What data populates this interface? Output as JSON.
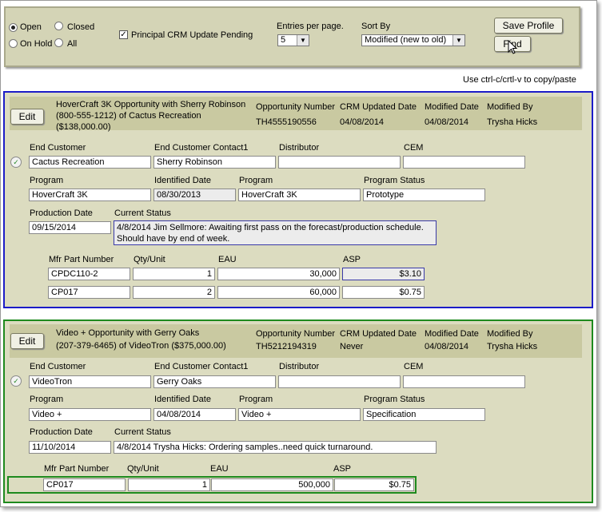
{
  "toolbar": {
    "status_options": [
      {
        "label": "Open",
        "selected": true
      },
      {
        "label": "Closed",
        "selected": false
      },
      {
        "label": "On Hold",
        "selected": false
      },
      {
        "label": "All",
        "selected": false
      }
    ],
    "pending_label": "Principal CRM Update Pending",
    "pending_checked": true,
    "entries_label": "Entries per page.",
    "entries_value": "5",
    "sortby_label": "Sort By",
    "sortby_value": "Modified (new to old)",
    "save_profile_label": "Save Profile",
    "find_label": "Find"
  },
  "hint": "Use ctrl-c/crtl-v to copy/paste",
  "labels": {
    "edit": "Edit",
    "opportunity_number": "Opportunity Number",
    "crm_updated_date": "CRM Updated Date",
    "modified_date": "Modified Date",
    "modified_by": "Modified By",
    "end_customer": "End Customer",
    "end_customer_contact": "End Customer Contact1",
    "distributor": "Distributor",
    "cem": "CEM",
    "program": "Program",
    "identified_date": "Identified Date",
    "program_status": "Program Status",
    "production_date": "Production Date",
    "current_status": "Current Status",
    "mfr_part_number": "Mfr Part Number",
    "qty_unit": "Qty/Unit",
    "eau": "EAU",
    "asp": "ASP"
  },
  "opportunities": [
    {
      "title_line1": "HoverCraft 3K Opportunity with Sherry Robinson",
      "title_line2": "(800-555-1212) of Cactus Recreation",
      "title_line3": "($138,000.00)",
      "opportunity_number": "TH4555190556",
      "crm_updated_date": "04/08/2014",
      "modified_date": "04/08/2014",
      "modified_by": "Trysha Hicks",
      "end_customer": "Cactus Recreation",
      "end_customer_contact": "Sherry Robinson",
      "distributor": "",
      "cem": "",
      "program": "HoverCraft 3K",
      "identified_date": "08/30/2013",
      "program2": "HoverCraft 3K",
      "program_status": "Prototype",
      "production_date": "09/15/2014",
      "current_status": "4/8/2014 Jim Sellmore: Awaiting first pass on the forecast/production schedule. Should have by end of week.",
      "parts": [
        {
          "mfr": "CPDC110-2",
          "qty": "1",
          "eau": "30,000",
          "asp": "$3.10"
        },
        {
          "mfr": "CP017",
          "qty": "2",
          "eau": "60,000",
          "asp": "$0.75"
        }
      ]
    },
    {
      "title_line1": "Video + Opportunity with Gerry Oaks",
      "title_line2": "(207-379-6465) of VideoTron ($375,000.00)",
      "title_line3": "",
      "opportunity_number": "TH5212194319",
      "crm_updated_date": "Never",
      "modified_date": "04/08/2014",
      "modified_by": "Trysha Hicks",
      "end_customer": "VideoTron",
      "end_customer_contact": "Gerry Oaks",
      "distributor": "",
      "cem": "",
      "program": "Video +",
      "identified_date": "04/08/2014",
      "program2": "Video +",
      "program_status": "Specification",
      "production_date": "11/10/2014",
      "current_status": "4/8/2014 Trysha Hicks: Ordering samples..need quick turnaround.",
      "parts": [
        {
          "mfr": "CP017",
          "qty": "1",
          "eau": "500,000",
          "asp": "$0.75"
        }
      ]
    }
  ]
}
